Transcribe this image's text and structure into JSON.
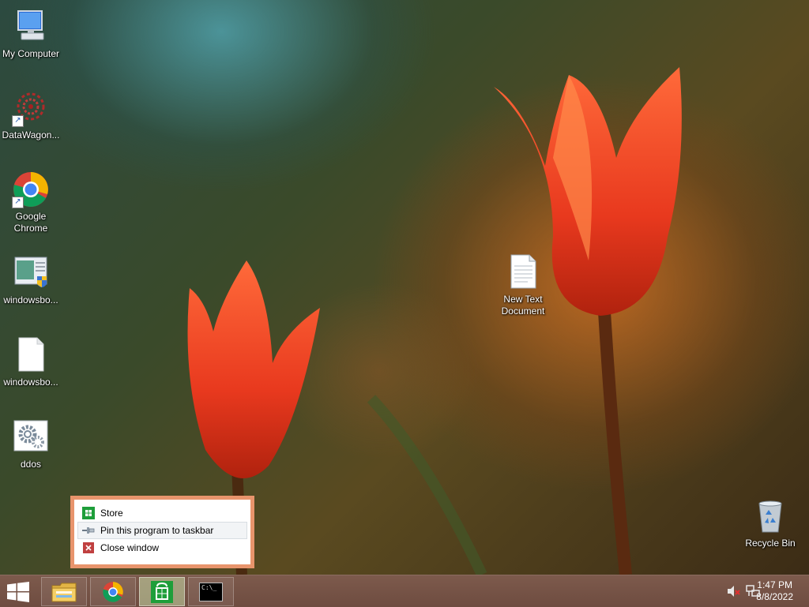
{
  "desktop": {
    "icons": [
      {
        "label": "My Computer",
        "icon": "computer-icon"
      },
      {
        "label": "DataWagon...",
        "icon": "datawagon-icon"
      },
      {
        "label": "Google Chrome",
        "icon": "chrome-icon"
      },
      {
        "label": "windowsbo...",
        "icon": "installer-icon"
      },
      {
        "label": "windowsbo...",
        "icon": "blank-file-icon"
      },
      {
        "label": "ddos",
        "icon": "settings-file-icon"
      },
      {
        "label": "New Text Document",
        "icon": "text-file-icon"
      },
      {
        "label": "Recycle Bin",
        "icon": "recycle-bin-icon"
      }
    ]
  },
  "jumplist": {
    "items": [
      {
        "label": "Store",
        "icon": "store-icon"
      },
      {
        "label": "Pin this program to taskbar",
        "icon": "pin-icon"
      },
      {
        "label": "Close window",
        "icon": "close-icon"
      }
    ]
  },
  "taskbar": {
    "buttons": [
      {
        "name": "file-explorer",
        "icon": "folder-icon"
      },
      {
        "name": "chrome",
        "icon": "chrome-icon"
      },
      {
        "name": "store",
        "icon": "store-icon",
        "active": true
      },
      {
        "name": "command-prompt",
        "icon": "cmd-icon"
      }
    ],
    "cmd_glyph": "C:\\_",
    "clock": {
      "time": "1:47 PM",
      "date": "8/8/2022"
    }
  },
  "colors": {
    "taskbar": "#6e4c40",
    "jumplist_border": "#e8946c",
    "store_green": "#1e9e3a"
  }
}
